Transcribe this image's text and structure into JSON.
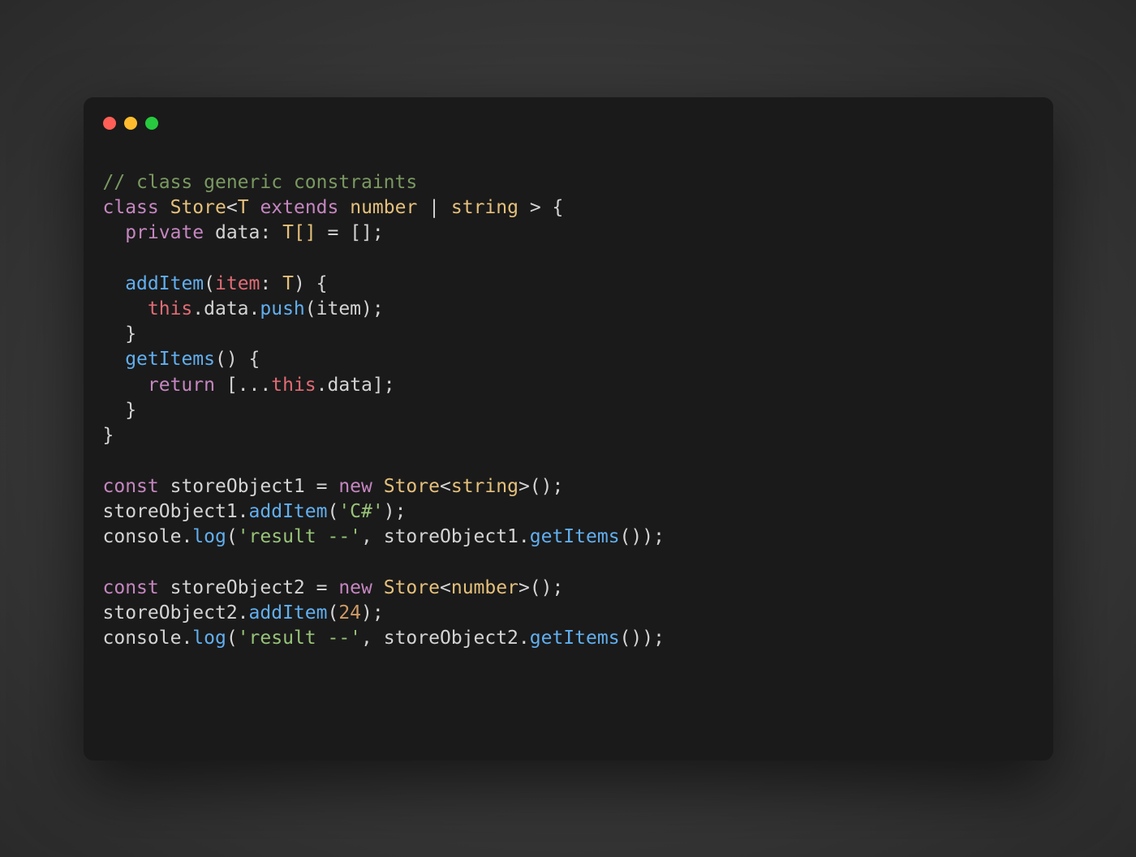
{
  "colors": {
    "red": "#ff5f56",
    "yellow": "#ffbd2e",
    "green": "#27c93f",
    "background": "#1a1a1a"
  },
  "code": {
    "line1": "// class generic constraints",
    "line2": {
      "class": "class",
      "name": "Store",
      "lt": "<",
      "t": "T",
      "extends": "extends",
      "number": "number",
      "pipe": " | ",
      "string": "string",
      "gt": " >",
      "brace": " {"
    },
    "line3": {
      "indent": "  ",
      "private": "private",
      "data": " data",
      "colon": ": ",
      "type": "T[]",
      "eq": " = ",
      "empty": "[]",
      "semi": ";"
    },
    "line5": {
      "indent": "  ",
      "method": "addItem",
      "paren_open": "(",
      "param": "item",
      "colon": ": ",
      "type": "T",
      "paren_close": ")",
      "brace": " {"
    },
    "line6": {
      "indent": "    ",
      "this": "this",
      "dot1": ".",
      "data": "data",
      "dot2": ".",
      "push": "push",
      "paren_open": "(",
      "item": "item",
      "paren_close": ")",
      "semi": ";"
    },
    "line7": {
      "indent": "  ",
      "brace": "}"
    },
    "line8": {
      "indent": "  ",
      "method": "getItems",
      "parens": "()",
      "brace": " {"
    },
    "line9": {
      "indent": "    ",
      "return": "return",
      "sp": " ",
      "bracket_open": "[",
      "spread": "...",
      "this": "this",
      "dot": ".",
      "data": "data",
      "bracket_close": "]",
      "semi": ";"
    },
    "line10": {
      "indent": "  ",
      "brace": "}"
    },
    "line11": {
      "brace": "}"
    },
    "line13": {
      "const": "const",
      "sp": " ",
      "var": "storeObject1",
      "eq": " = ",
      "new": "new",
      "sp2": " ",
      "class": "Store",
      "lt": "<",
      "type": "string",
      "gt": ">",
      "parens": "()",
      "semi": ";"
    },
    "line14": {
      "var": "storeObject1",
      "dot": ".",
      "method": "addItem",
      "paren_open": "(",
      "string": "'C#'",
      "paren_close": ")",
      "semi": ";"
    },
    "line15": {
      "console": "console",
      "dot1": ".",
      "log": "log",
      "paren_open": "(",
      "string": "'result --'",
      "comma": ", ",
      "var": "storeObject1",
      "dot2": ".",
      "method": "getItems",
      "parens": "()",
      "paren_close": ")",
      "semi": ";"
    },
    "line17": {
      "const": "const",
      "sp": " ",
      "var": "storeObject2",
      "eq": " = ",
      "new": "new",
      "sp2": " ",
      "class": "Store",
      "lt": "<",
      "type": "number",
      "gt": ">",
      "parens": "()",
      "semi": ";"
    },
    "line18": {
      "var": "storeObject2",
      "dot": ".",
      "method": "addItem",
      "paren_open": "(",
      "number": "24",
      "paren_close": ")",
      "semi": ";"
    },
    "line19": {
      "console": "console",
      "dot1": ".",
      "log": "log",
      "paren_open": "(",
      "string": "'result --'",
      "comma": ", ",
      "var": "storeObject2",
      "dot2": ".",
      "method": "getItems",
      "parens": "()",
      "paren_close": ")",
      "semi": ";"
    }
  }
}
